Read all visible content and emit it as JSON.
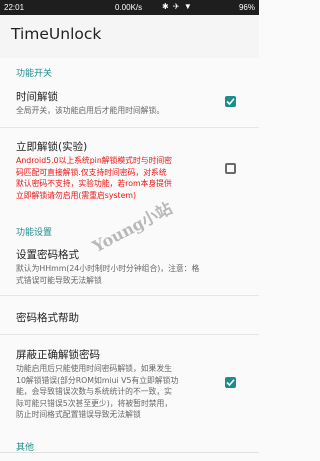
{
  "status": {
    "time": "22:01",
    "speed": "0.00K/s",
    "icons": "✱ ✈ ▼",
    "battery": "96%"
  },
  "app": {
    "title": "TimeUnlock"
  },
  "sections": {
    "switch": "功能开关",
    "settings": "功能设置",
    "other": "其他"
  },
  "prefs": {
    "time_unlock": {
      "title": "时间解锁",
      "summary": "全局开关，该功能启用后才能用时间解锁。",
      "checked": true
    },
    "instant_unlock": {
      "title": "立即解锁(实验)",
      "summary_lines": [
        "Android5.0以上系统pin解锁模式时与时间密",
        "码匹配可直接解锁.仅支持时间密码，对系统",
        "默认密码不支持，实验功能，若rom本身提供",
        "立即解锁请勿启用(需重启system)"
      ],
      "checked": false
    },
    "password_format": {
      "title": "设置密码格式",
      "summary_lines": [
        "默认为HHmm(24小时制时小时分钟组合)，注意：格",
        "式错误可能导致无法解锁"
      ]
    },
    "format_help": {
      "title": "密码格式帮助"
    },
    "block_correct": {
      "title": "屏蔽正确解锁密码",
      "summary_lines": [
        "功能启用后只能使用时间密码解锁，如果发生",
        "10解锁错误(部分ROM如miui V5有立即解锁功",
        "能，会导致错误次数与系统统计的不一致，实",
        "际可能只错误5次甚至更少)，将被暂时禁用，",
        "防止时间格式配置错误导致无法解锁"
      ],
      "checked": true
    }
  },
  "watermark": "Young小站"
}
